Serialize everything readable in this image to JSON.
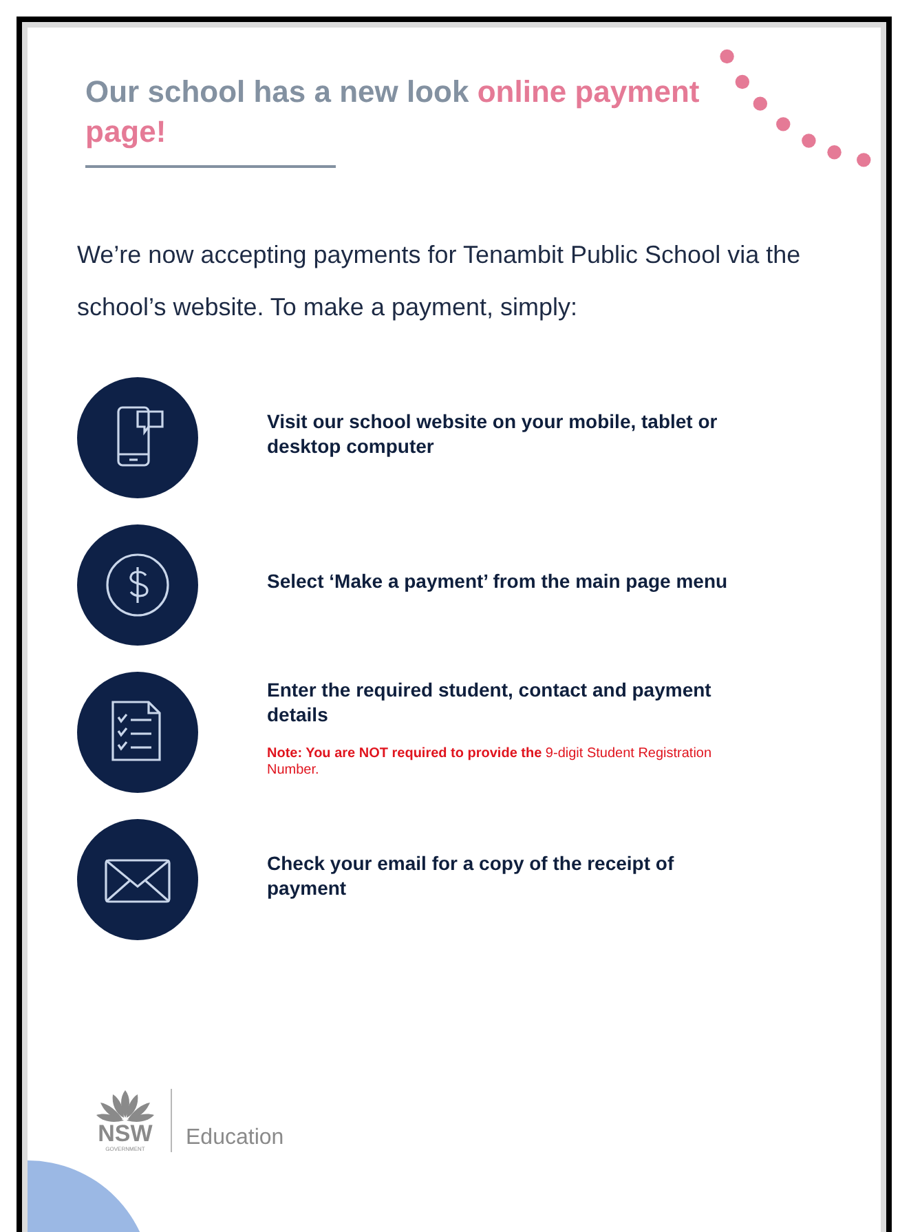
{
  "heading": {
    "text": "Our school has a new look",
    "highlight": "online payment page!"
  },
  "intro": "We’re now accepting payments for Tenambit Public School via the school’s website. To make a payment, simply:",
  "steps": [
    {
      "kind": "phone",
      "text": "Visit our school website on your mobile, tablet or desktop computer"
    },
    {
      "kind": "dollar",
      "text": "Select ‘Make a payment’ from the main page menu"
    },
    {
      "kind": "checklist",
      "text": "Enter the required student, contact and payment details",
      "note": "**Note: You are NOT required to provide the** 9-digit Student Registration Number."
    },
    {
      "kind": "envelope",
      "text": "Check your email for a copy of the receipt of payment"
    }
  ],
  "footer": {
    "logo_word": "NSW",
    "logo_subtext": "GOVERNMENT",
    "department": "Education"
  }
}
